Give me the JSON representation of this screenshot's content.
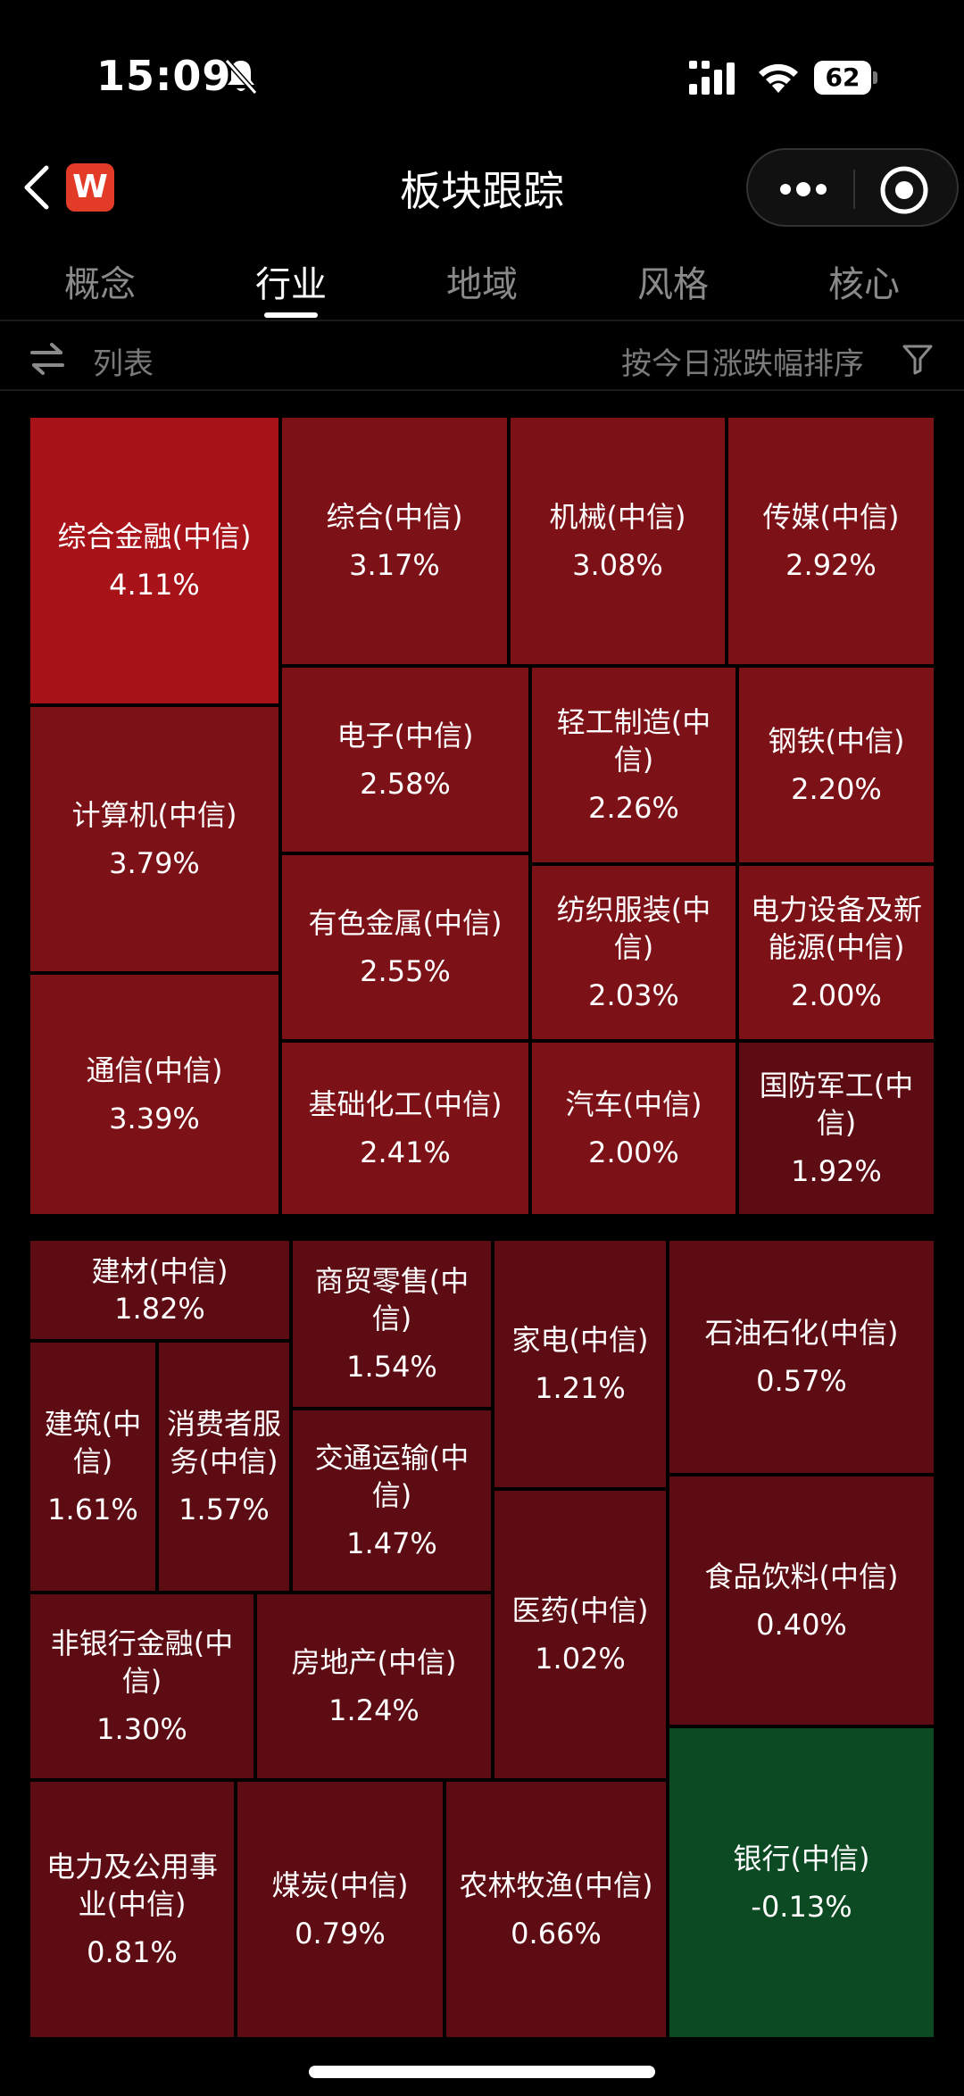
{
  "status_bar": {
    "time": "15:09",
    "battery": "62"
  },
  "nav": {
    "title": "板块跟踪",
    "logo_letter": "W"
  },
  "tabs": [
    {
      "label": "概念"
    },
    {
      "label": "行业"
    },
    {
      "label": "地域"
    },
    {
      "label": "风格"
    },
    {
      "label": "核心"
    }
  ],
  "active_tab": "行业",
  "toolbar": {
    "list_label": "列表",
    "sort_label": "按今日涨跌幅排序"
  },
  "colors": {
    "strong_up": "#a71318",
    "up": "#7c1217",
    "mild_up": "#5e0c14",
    "down": "#0b4a22"
  },
  "group1": [
    {
      "name": "综合金融(中信)",
      "pct": "4.11%"
    },
    {
      "name": "综合(中信)",
      "pct": "3.17%"
    },
    {
      "name": "机械(中信)",
      "pct": "3.08%"
    },
    {
      "name": "传媒(中信)",
      "pct": "2.92%"
    },
    {
      "name": "计算机(中信)",
      "pct": "3.79%"
    },
    {
      "name": "电子(中信)",
      "pct": "2.58%"
    },
    {
      "name": "轻工制造(中信)",
      "pct": "2.26%"
    },
    {
      "name": "钢铁(中信)",
      "pct": "2.20%"
    },
    {
      "name": "有色金属(中信)",
      "pct": "2.55%"
    },
    {
      "name": "纺织服装(中信)",
      "pct": "2.03%"
    },
    {
      "name": "电力设备及新能源(中信)",
      "pct": "2.00%"
    },
    {
      "name": "通信(中信)",
      "pct": "3.39%"
    },
    {
      "name": "基础化工(中信)",
      "pct": "2.41%"
    },
    {
      "name": "汽车(中信)",
      "pct": "2.00%"
    },
    {
      "name": "国防军工(中信)",
      "pct": "1.92%"
    }
  ],
  "group2": [
    {
      "name": "建材(中信)",
      "pct": "1.82%"
    },
    {
      "name": "商贸零售(中信)",
      "pct": "1.54%"
    },
    {
      "name": "家电(中信)",
      "pct": "1.21%"
    },
    {
      "name": "石油石化(中信)",
      "pct": "0.57%"
    },
    {
      "name": "建筑(中信)",
      "pct": "1.61%"
    },
    {
      "name": "消费者服务(中信)",
      "pct": "1.57%"
    },
    {
      "name": "交通运输(中信)",
      "pct": "1.47%"
    },
    {
      "name": "食品饮料(中信)",
      "pct": "0.40%"
    },
    {
      "name": "非银行金融(中信)",
      "pct": "1.30%"
    },
    {
      "name": "房地产(中信)",
      "pct": "1.24%"
    },
    {
      "name": "医药(中信)",
      "pct": "1.02%"
    },
    {
      "name": "电力及公用事业(中信)",
      "pct": "0.81%"
    },
    {
      "name": "煤炭(中信)",
      "pct": "0.79%"
    },
    {
      "name": "农林牧渔(中信)",
      "pct": "0.66%"
    },
    {
      "name": "银行(中信)",
      "pct": "-0.13%"
    }
  ]
}
